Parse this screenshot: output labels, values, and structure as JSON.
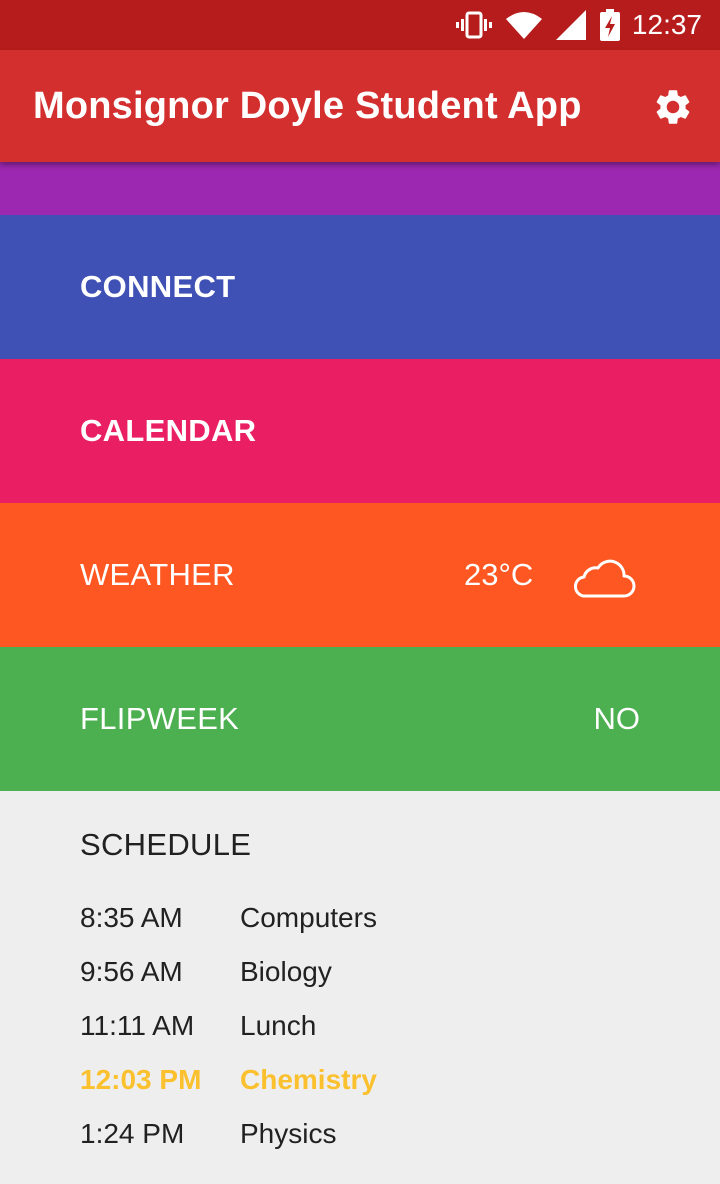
{
  "status_bar": {
    "time": "12:37"
  },
  "app_bar": {
    "title": "Monsignor Doyle Student App"
  },
  "menu": {
    "connect_label": "CONNECT",
    "calendar_label": "CALENDAR",
    "weather_label": "WEATHER",
    "weather_temp": "23°C",
    "flipweek_label": "FLIPWEEK",
    "flipweek_value": "NO"
  },
  "schedule": {
    "heading": "SCHEDULE",
    "rows": [
      {
        "time": "8:35 AM",
        "subject": "Computers"
      },
      {
        "time": "9:56 AM",
        "subject": "Biology"
      },
      {
        "time": "11:11 AM",
        "subject": "Lunch"
      },
      {
        "time": "12:03 PM",
        "subject": "Chemistry",
        "current": true
      },
      {
        "time": "1:24 PM",
        "subject": "Physics"
      }
    ]
  },
  "colors": {
    "status_bar": "#b71c1c",
    "app_bar": "#d32f2f",
    "purple": "#9c27b0",
    "connect": "#3f51b5",
    "calendar": "#e91e63",
    "weather": "#ff5722",
    "flipweek": "#4caf50",
    "current_class": "#fbc02d"
  },
  "icons": [
    "vibrate-icon",
    "wifi-icon",
    "signal-icon",
    "battery-charging-icon",
    "settings-gear-icon",
    "cloud-icon"
  ]
}
